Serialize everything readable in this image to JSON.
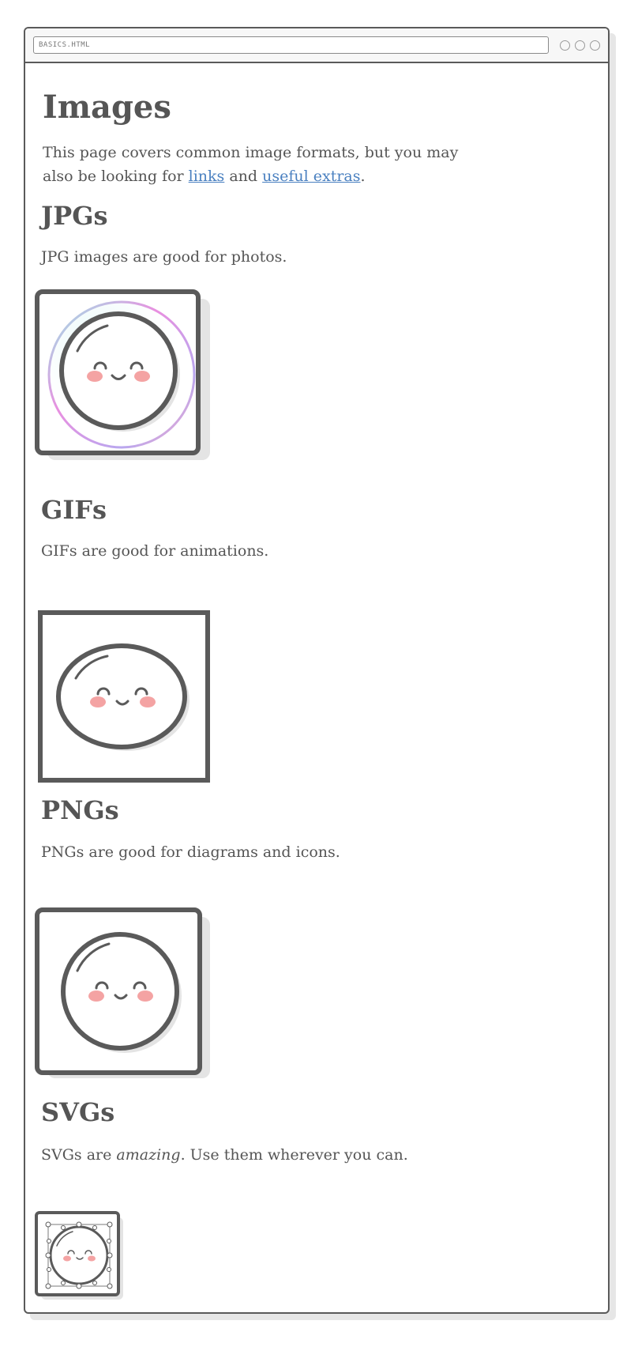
{
  "browser": {
    "address": "BASICS.HTML"
  },
  "page": {
    "title": "Images",
    "intro_before": "This page covers common image formats, but you may also be looking for ",
    "intro_link1": "links",
    "intro_between": " and ",
    "intro_link2": "useful extras",
    "intro_after": "."
  },
  "sections": [
    {
      "heading": "JPGs",
      "text": "JPG images are good for photos."
    },
    {
      "heading": "GIFs",
      "text": "GIFs are good for animations."
    },
    {
      "heading": "PNGs",
      "text": "PNGs are good for diagrams and icons."
    },
    {
      "heading": "SVGs",
      "text_before": "SVGs are ",
      "text_em": "amazing",
      "text_after": ". Use them wherever you can."
    }
  ],
  "colors": {
    "text": "#555555",
    "link": "#4a80c0",
    "outline": "#5a5a5a",
    "blush": "#f4a3a3"
  }
}
